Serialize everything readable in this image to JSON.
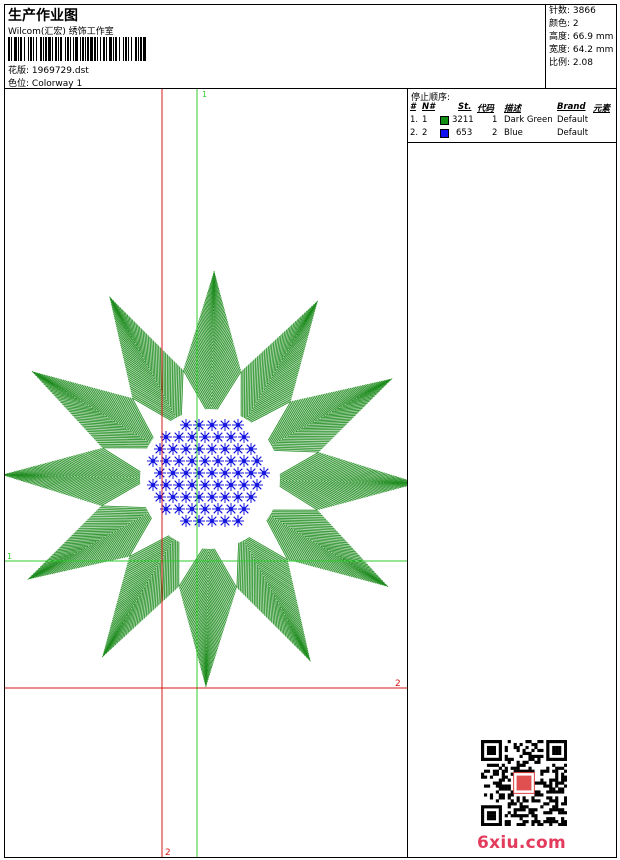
{
  "header": {
    "title": "生产作业图",
    "company": "Wilcom(汇宏) 绣饰工作室",
    "pattern_label": "花版:",
    "pattern_value": "1969729.dst",
    "colorway_label": "色位:",
    "colorway_value": "Colorway 1"
  },
  "stats": [
    {
      "label": "针数:",
      "value": "3866"
    },
    {
      "label": "颜色:",
      "value": "2"
    },
    {
      "label": "高度:",
      "value": "66.9 mm"
    },
    {
      "label": "宽度:",
      "value": "64.2 mm"
    },
    {
      "label": "比例:",
      "value": "2.08"
    }
  ],
  "design": {
    "green_guide_label_v": "1",
    "green_guide_label_h": "1",
    "red_guide_label_h": "2",
    "red_guide_label_v": "2",
    "thread_colors": {
      "green": "#1a8a1a",
      "blue": "#1515e0",
      "guide_green": "#2ecc2e",
      "guide_red": "#d41818"
    }
  },
  "stop_sequence": {
    "title": "停止顺序:",
    "headers": {
      "num": "#",
      "no": "N#",
      "st": "St.",
      "code": "代码",
      "desc": "描述",
      "brand": "Brand",
      "elem": "元素"
    },
    "rows": [
      {
        "num": "1.",
        "no": "1",
        "color": "#138f13",
        "st": "3211",
        "code": "1",
        "desc": "Dark Green",
        "brand": "Default"
      },
      {
        "num": "2.",
        "no": "2",
        "color": "#1010f0",
        "st": "653",
        "code": "2",
        "desc": "Blue",
        "brand": "Default"
      }
    ]
  },
  "watermark": {
    "text": "6xiu.com",
    "color": "#e33b5b"
  }
}
